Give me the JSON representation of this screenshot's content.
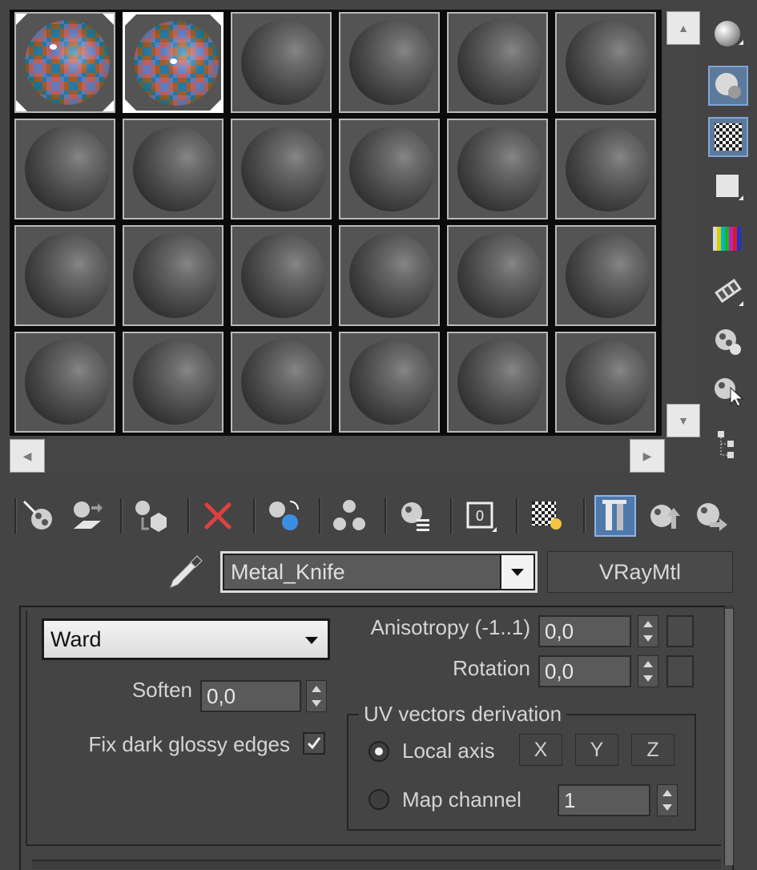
{
  "material_name": "Metal_Knife",
  "material_type_button": "VRayMtl",
  "brdf": {
    "type_selected": "Ward",
    "soften_label": "Soften",
    "soften_value": "0,0",
    "fix_dark_glossy_label": "Fix dark glossy edges",
    "fix_dark_glossy_checked": true,
    "anisotropy_label": "Anisotropy (-1..1)",
    "anisotropy_value": "0,0",
    "rotation_label": "Rotation",
    "rotation_value": "0,0",
    "uv_group_title": "UV vectors derivation",
    "local_axis_label": "Local axis",
    "axis_buttons": [
      "X",
      "Y",
      "Z"
    ],
    "map_channel_label": "Map channel",
    "map_channel_value": "1",
    "selected_derivation": "Local axis"
  },
  "sample_slots": {
    "rows": 4,
    "columns": 6,
    "checker_slots": [
      0,
      1
    ],
    "active_slot": 1
  },
  "icons": {
    "side": [
      "sample-type-sphere-icon",
      "backlight-icon",
      "background-checker-icon",
      "sample-uv-tiling-icon",
      "video-color-check-icon",
      "make-preview-icon",
      "options-icon",
      "select-by-material-icon",
      "material-map-navigator-icon"
    ],
    "toolbar": [
      "get-material-icon",
      "put-to-scene-icon",
      "assign-to-selection-icon",
      "reset-map-icon",
      "make-copy-icon",
      "make-unique-icon",
      "put-to-library-icon",
      "material-id-channel-icon",
      "show-map-in-viewport-icon",
      "show-end-result-icon",
      "go-to-parent-icon",
      "go-forward-to-sibling-icon"
    ]
  },
  "colors": {
    "panel_bg": "#444444",
    "active_button": "#4f79ad",
    "delete_icon": "#e04040"
  }
}
